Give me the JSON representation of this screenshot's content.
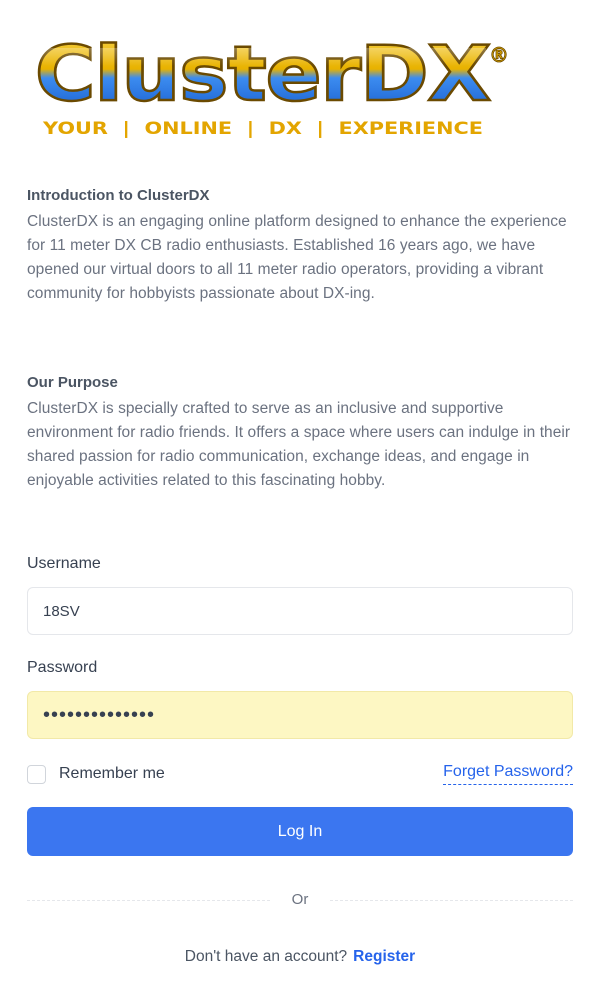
{
  "logo": {
    "wordmark": "ClusterDX",
    "registered": "®",
    "tagline": "YOUR  |  ONLINE  |  DX  |  EXPERIENCE",
    "colors": {
      "gold": "#d9a400",
      "blue": "#1e6fd9",
      "tagline": "#e3a500"
    }
  },
  "intro": {
    "title": "Introduction to ClusterDX",
    "body": "ClusterDX is an engaging online platform designed to enhance the experience for 11 meter DX CB radio enthusiasts. Established 16 years ago, we have opened our virtual doors to all 11 meter radio operators, providing a vibrant community for hobbyists passionate about DX-ing."
  },
  "purpose": {
    "title": "Our Purpose",
    "body": "ClusterDX is specially crafted to serve as an inclusive and supportive environment for radio friends. It offers a space where users can indulge in their shared passion for radio communication, exchange ideas, and engage in enjoyable activities related to this fascinating hobby."
  },
  "form": {
    "username_label": "Username",
    "username_value": "18SV",
    "password_label": "Password",
    "password_value": "••••••••••••••",
    "remember_label": "Remember me",
    "remember_checked": false,
    "forgot_label": "Forget Password?",
    "login_label": "Log In",
    "divider_text": "Or",
    "signup_prompt": "Don't have an account?",
    "register_label": "Register"
  },
  "colors": {
    "primary": "#3b76f0",
    "link": "#2563eb",
    "autofill": "#fdf7c3"
  }
}
